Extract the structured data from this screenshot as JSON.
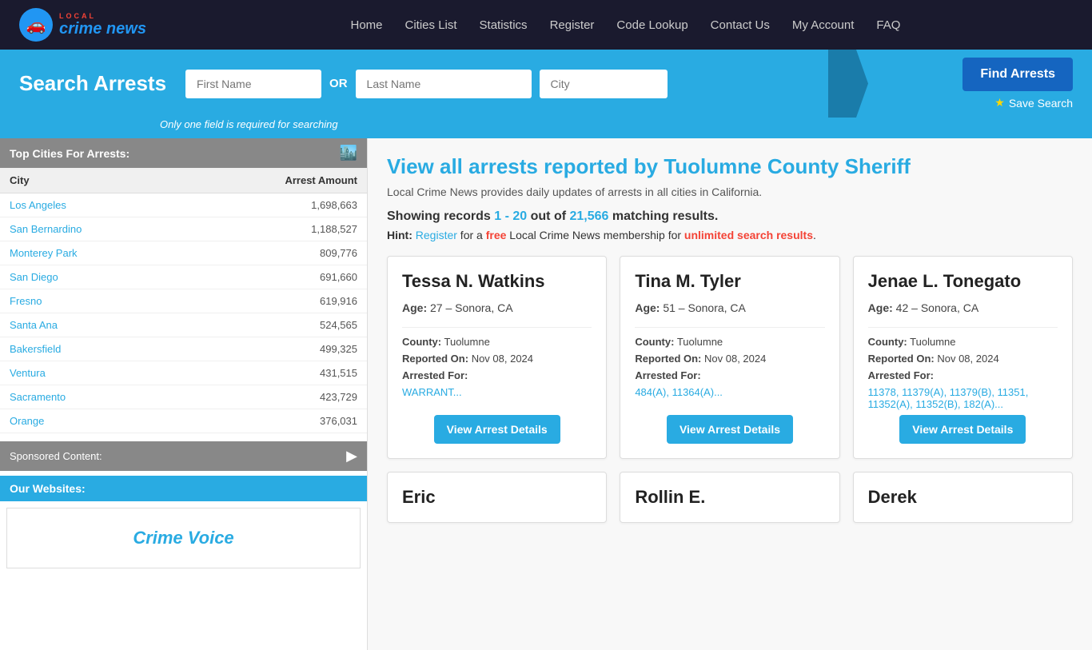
{
  "nav": {
    "logo_text": "crime news",
    "logo_local": "LOCAL",
    "links": [
      {
        "label": "Home",
        "name": "home"
      },
      {
        "label": "Cities List",
        "name": "cities-list"
      },
      {
        "label": "Statistics",
        "name": "statistics"
      },
      {
        "label": "Register",
        "name": "register"
      },
      {
        "label": "Code Lookup",
        "name": "code-lookup"
      },
      {
        "label": "Contact Us",
        "name": "contact-us"
      },
      {
        "label": "My Account",
        "name": "my-account"
      },
      {
        "label": "FAQ",
        "name": "faq"
      }
    ]
  },
  "search": {
    "title": "Search Arrests",
    "first_name_placeholder": "First Name",
    "or_text": "OR",
    "last_name_placeholder": "Last Name",
    "city_placeholder": "City",
    "hint": "Only one field is required for searching",
    "find_button": "Find Arrests",
    "save_label": "Save Search"
  },
  "sidebar": {
    "top_cities_header": "Top Cities For Arrests:",
    "city_col": "City",
    "arrest_col": "Arrest Amount",
    "cities": [
      {
        "name": "Los Angeles",
        "count": "1,698,663"
      },
      {
        "name": "San Bernardino",
        "count": "1,188,527"
      },
      {
        "name": "Monterey Park",
        "count": "809,776"
      },
      {
        "name": "San Diego",
        "count": "691,660"
      },
      {
        "name": "Fresno",
        "count": "619,916"
      },
      {
        "name": "Santa Ana",
        "count": "524,565"
      },
      {
        "name": "Bakersfield",
        "count": "499,325"
      },
      {
        "name": "Ventura",
        "count": "431,515"
      },
      {
        "name": "Sacramento",
        "count": "423,729"
      },
      {
        "name": "Orange",
        "count": "376,031"
      }
    ],
    "sponsored_label": "Sponsored Content:",
    "our_websites_label": "Our Websites:",
    "crime_voice_label": "Crime Voice"
  },
  "main": {
    "page_title": "View all arrests reported by Tuolumne County Sheriff",
    "subtitle": "Local Crime News provides daily updates of arrests in all cities in California.",
    "showing_prefix": "Showing records ",
    "showing_range": "1 - 20",
    "showing_middle": " out of ",
    "showing_count": "21,566",
    "showing_suffix": " matching results.",
    "hint_prefix": "Hint: ",
    "hint_register": "Register",
    "hint_middle": " for a ",
    "hint_free": "free",
    "hint_after": " Local Crime News membership for ",
    "hint_unlimited": "unlimited search results",
    "hint_end": ".",
    "cards": [
      {
        "name": "Tessa N. Watkins",
        "age_label": "Age:",
        "age": "27",
        "location": "Sonora, CA",
        "county_label": "County:",
        "county": "Tuolumne",
        "reported_label": "Reported On:",
        "reported": "Nov 08, 2024",
        "arrested_label": "Arrested For:",
        "charges": "WARRANT...",
        "btn": "View Arrest Details"
      },
      {
        "name": "Tina M. Tyler",
        "age_label": "Age:",
        "age": "51",
        "location": "Sonora, CA",
        "county_label": "County:",
        "county": "Tuolumne",
        "reported_label": "Reported On:",
        "reported": "Nov 08, 2024",
        "arrested_label": "Arrested For:",
        "charges": "484(A), 11364(A)...",
        "btn": "View Arrest Details"
      },
      {
        "name": "Jenae L. Tonegato",
        "age_label": "Age:",
        "age": "42",
        "location": "Sonora, CA",
        "county_label": "County:",
        "county": "Tuolumne",
        "reported_label": "Reported On:",
        "reported": "Nov 08, 2024",
        "arrested_label": "Arrested For:",
        "charges": "11378, 11379(A), 11379(B), 11351, 11352(A), 11352(B), 182(A)...",
        "btn": "View Arrest Details"
      }
    ],
    "partial_cards": [
      {
        "name": "Eric"
      },
      {
        "name": "Rollin E."
      },
      {
        "name": "Derek"
      }
    ]
  }
}
